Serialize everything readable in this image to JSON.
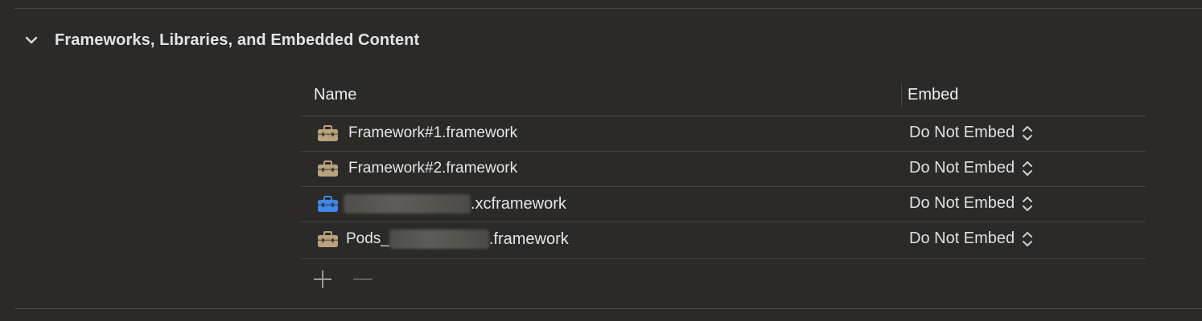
{
  "section": {
    "title": "Frameworks, Libraries, and Embedded Content",
    "chevron_icon": "chevron-down-icon"
  },
  "table": {
    "columns": {
      "name": "Name",
      "embed": "Embed"
    },
    "rows": [
      {
        "icon": "toolbox-icon",
        "icon_color": "#b9a27c",
        "prefix": "Framework#1.framework",
        "redacted": false,
        "suffix": "",
        "embed": "Do Not Embed"
      },
      {
        "icon": "toolbox-icon",
        "icon_color": "#b9a27c",
        "prefix": "Framework#2.framework",
        "redacted": false,
        "suffix": "",
        "embed": "Do Not Embed"
      },
      {
        "icon": "toolbox-icon",
        "icon_color": "#3f86e8",
        "prefix": "",
        "redacted": true,
        "suffix": ".xcframework",
        "embed": "Do Not Embed"
      },
      {
        "icon": "toolbox-icon",
        "icon_color": "#b9a27c",
        "prefix": "Pods_",
        "redacted": true,
        "suffix": ".framework",
        "embed": "Do Not Embed"
      }
    ]
  },
  "controls": {
    "add_icon": "plus-icon",
    "remove_icon": "minus-icon"
  },
  "colors": {
    "background": "#2b2a28",
    "accent_blue": "#3f86e8",
    "framework_tan": "#b9a27c"
  }
}
